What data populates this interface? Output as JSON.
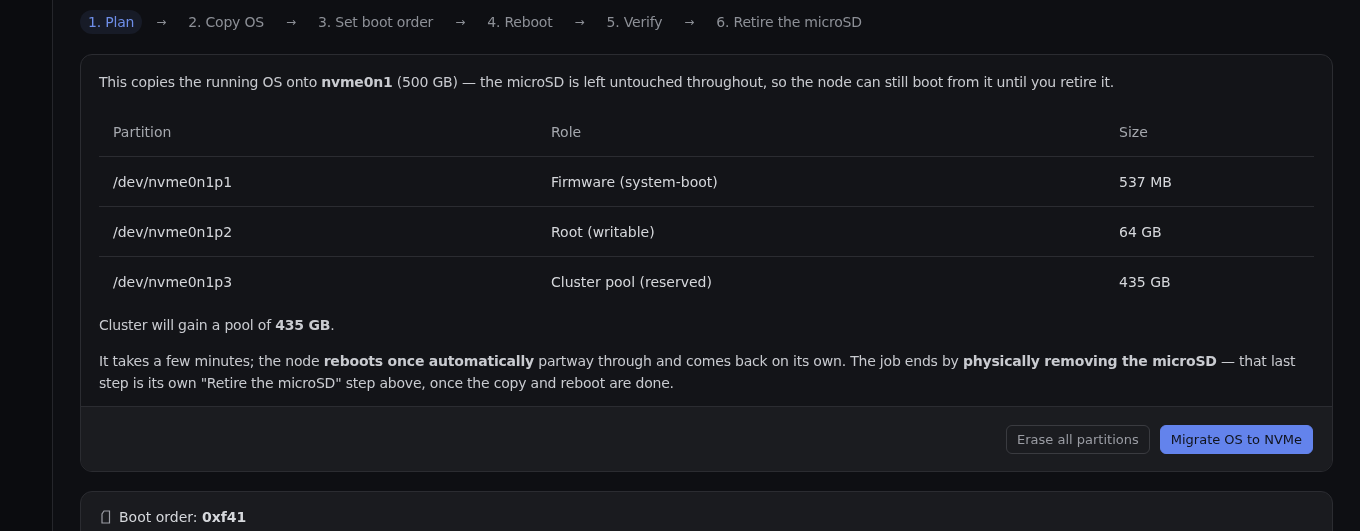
{
  "steps": [
    {
      "number": "1.",
      "label": "Plan",
      "selected": true
    },
    {
      "arrow": "→",
      "number": "2.",
      "label": "Copy OS",
      "selected": false
    },
    {
      "arrow": "→",
      "number": "3.",
      "label": "Set boot order",
      "selected": false
    },
    {
      "arrow": "→",
      "number": "4.",
      "label": "Reboot",
      "selected": false
    },
    {
      "arrow": "→",
      "number": "5.",
      "label": "Verify",
      "selected": false
    },
    {
      "arrow": "→",
      "number": "6.",
      "label": "Retire the microSD",
      "selected": false
    }
  ],
  "plan_card": {
    "intro": "This copies the running OS onto **nvme0n1** (500 GB) — the microSD is left untouched throughout, so the node can still boot from it until you retire it.",
    "table": {
      "columns": [
        "Partition",
        "Role",
        "Size"
      ],
      "rows": [
        [
          "/dev/nvme0n1p1",
          "Firmware (system-boot)",
          "537 MB"
        ],
        [
          "/dev/nvme0n1p2",
          "Root (writable)",
          "64 GB"
        ],
        [
          "/dev/nvme0n1p3",
          "Cluster pool (reserved)",
          "435 GB"
        ]
      ]
    },
    "pool_note": "Cluster will gain a pool of **435 GB**.",
    "explanation": "It takes a few minutes; the node **reboots once automatically** partway through and comes back on its own. The job ends by **physically removing the microSD** — that last step is its own \"Retire the microSD\" step above, once the copy and reboot are done.",
    "buttons": [
      {
        "label": "Erase all partitions",
        "kind": "secondary"
      },
      {
        "label": "Migrate OS to NVMe",
        "kind": "primary"
      }
    ]
  },
  "boot_card": {
    "title": "Boot order: **0xf41**"
  }
}
